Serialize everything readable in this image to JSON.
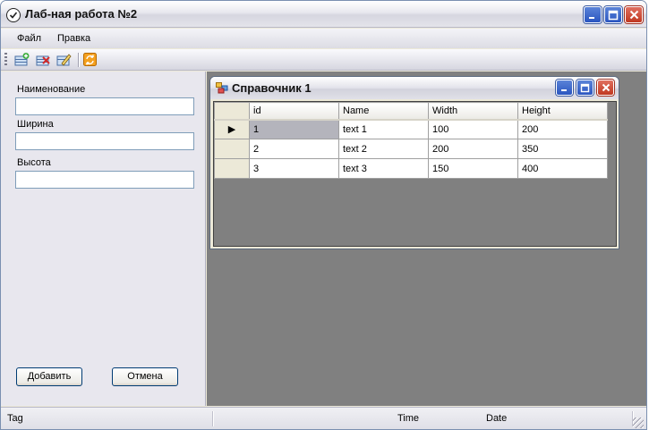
{
  "app": {
    "title": "Лаб-ная работа №2"
  },
  "menu": {
    "items": [
      "Файл",
      "Правка"
    ]
  },
  "toolbar": {
    "icons": [
      "add-record-icon",
      "delete-record-icon",
      "edit-record-icon",
      "refresh-icon"
    ]
  },
  "form": {
    "name_label": "Наименование",
    "name_value": "",
    "width_label": "Ширина",
    "width_value": "",
    "height_label": "Высота",
    "height_value": "",
    "add_button": "Добавить",
    "cancel_button": "Отмена"
  },
  "child": {
    "title": "Справочник 1",
    "columns": [
      "id",
      "Name",
      "Width",
      "Height"
    ],
    "rows": [
      [
        "1",
        "text 1",
        "100",
        "200"
      ],
      [
        "2",
        "text 2",
        "200",
        "350"
      ],
      [
        "3",
        "text 3",
        "150",
        "400"
      ]
    ],
    "current_row_marker": "▶"
  },
  "status": {
    "tag": "Tag",
    "time": "Time",
    "date": "Date"
  },
  "colors": {
    "titlebar_close": "#c03820",
    "titlebar_button": "#2a55c0",
    "mdi_background": "#808080"
  }
}
